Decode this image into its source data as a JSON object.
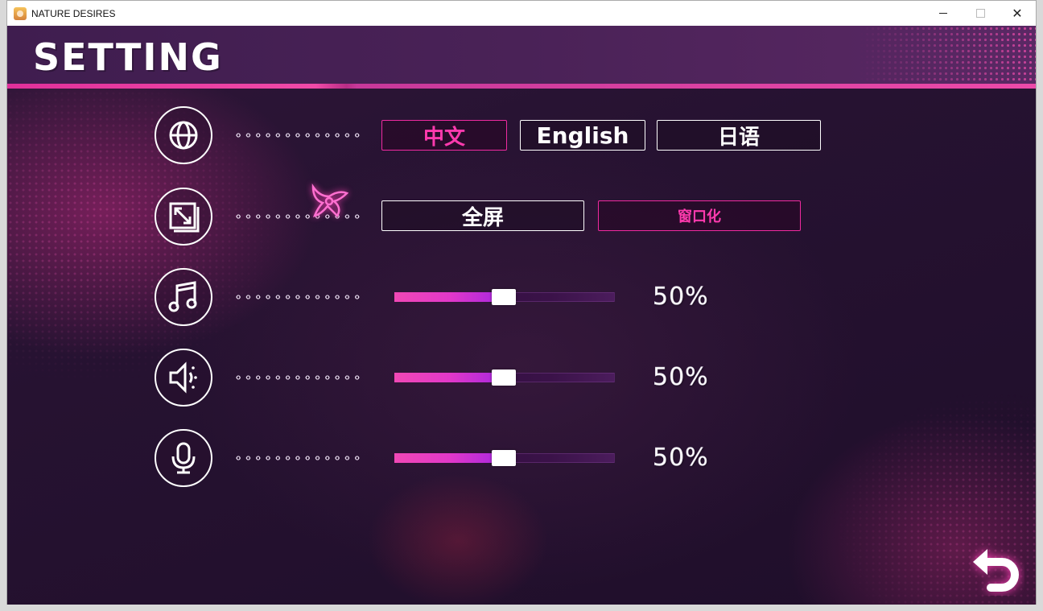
{
  "window": {
    "title": "NATURE DESIRES"
  },
  "header": {
    "title": "SETTING"
  },
  "language": {
    "options": [
      "中文",
      "English",
      "日语"
    ],
    "selected": "中文"
  },
  "display": {
    "options": [
      "全屏",
      "窗口化"
    ],
    "selected": "窗口化"
  },
  "music": {
    "value": 50,
    "label": "50%"
  },
  "sound": {
    "value": 50,
    "label": "50%"
  },
  "voice": {
    "value": 50,
    "label": "50%"
  },
  "colors": {
    "accent": "#f02aa0",
    "background": "#261231",
    "header": "#4a2257"
  },
  "icons": [
    "globe-icon",
    "resize-icon",
    "music-note-icon",
    "speaker-icon",
    "microphone-icon",
    "back-arrow-icon",
    "ornament-flower-icon"
  ]
}
